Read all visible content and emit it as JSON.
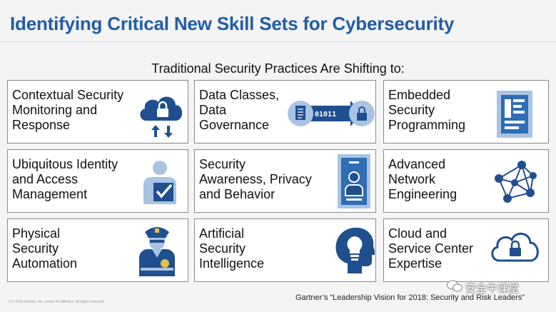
{
  "slide": {
    "title": "Identifying Critical New Skill Sets for Cybersecurity",
    "subtitle": "Traditional Security Practices Are Shifting to:",
    "footer_note": "5   © 2016 Gartner, Inc. and/or its affiliates. All rights reserved.",
    "source": "Gartner’s  “Leadership Vision for 2018: Security and Risk Leaders”",
    "watermark": "安全牛课堂"
  },
  "colors": {
    "title": "#1f5da8",
    "icon_dark": "#1f4f8f",
    "icon_mid": "#2f6db5",
    "icon_light": "#a9c4e3",
    "card_border": "#8a8a8a"
  },
  "cards": [
    {
      "label": "Contextual Security\nMonitoring and\nResponse",
      "icon": "cloud-lock-icon"
    },
    {
      "label": "Data Classes,\nData\nGovernance",
      "icon": "data-lock-arrow-icon",
      "code_text": "01011"
    },
    {
      "label": "Embedded\nSecurity\nProgramming",
      "icon": "document-code-icon"
    },
    {
      "label": "Ubiquitous Identity\nand Access\nManagement",
      "icon": "user-check-icon"
    },
    {
      "label": "Security\nAwareness, Privacy\nand Behavior",
      "icon": "id-badge-icon"
    },
    {
      "label": "Advanced\nNetwork\nEngineering",
      "icon": "network-nodes-icon"
    },
    {
      "label": "Physical\nSecurity\nAutomation",
      "icon": "security-guard-icon"
    },
    {
      "label": "Artificial\nSecurity\nIntelligence",
      "icon": "head-lightbulb-icon"
    },
    {
      "label": "Cloud and\nService Center\nExpertise",
      "icon": "cloud-service-icon"
    }
  ]
}
